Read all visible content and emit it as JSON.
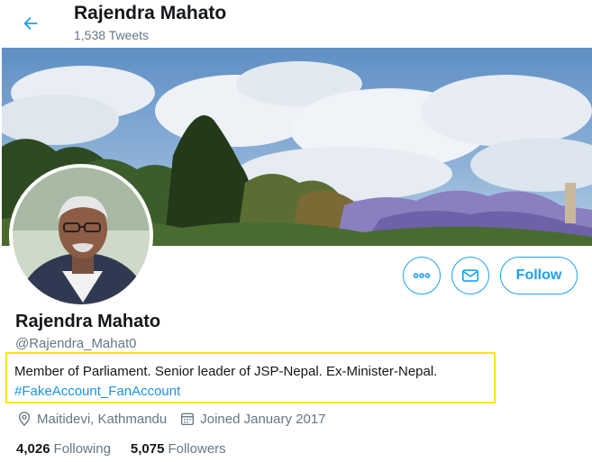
{
  "header": {
    "name": "Rajendra Mahato",
    "tweet_count": "1,538 Tweets"
  },
  "profile": {
    "name": "Rajendra Mahato",
    "handle": "@Rajendra_Mahat0",
    "bio": "Member of Parliament. Senior leader of JSP-Nepal. Ex-Minister-Nepal.",
    "bio_hashtag": "#FakeAccount_FanAccount",
    "location": "Maitidevi, Kathmandu",
    "joined": "Joined January 2017"
  },
  "actions": {
    "follow_label": "Follow"
  },
  "stats": {
    "following_count": "4,026",
    "following_label": "Following",
    "followers_count": "5,075",
    "followers_label": "Followers"
  },
  "icons": {
    "back": "arrow-left-icon",
    "more": "more-icon",
    "message": "envelope-icon",
    "location": "location-pin-icon",
    "calendar": "calendar-icon"
  },
  "colors": {
    "accent": "#1da1f2",
    "link": "#1b95e0",
    "secondary_text": "#657786",
    "highlight_box": "#ffe500"
  }
}
